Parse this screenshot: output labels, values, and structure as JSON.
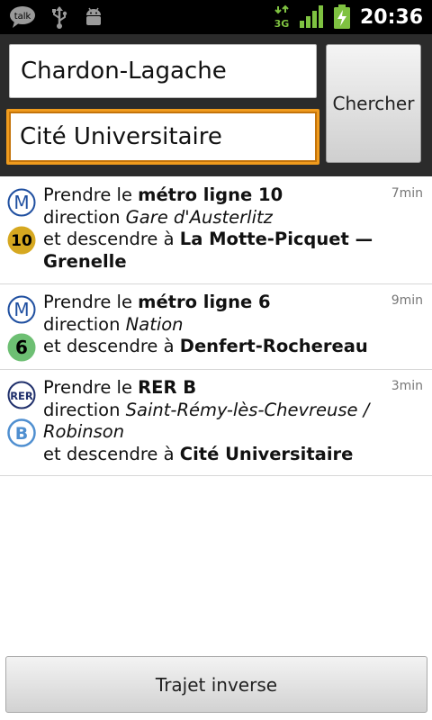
{
  "status_bar": {
    "time": "20:36",
    "talk_label": "talk",
    "network_label": "3G",
    "icons": [
      "talk-icon",
      "usb-icon",
      "android-debug-icon",
      "network-3g-icon",
      "signal-icon",
      "battery-charging-icon"
    ]
  },
  "search": {
    "from_value": "Chardon-Lagache",
    "to_value": "Cité Universitaire",
    "search_label": "Chercher"
  },
  "steps": [
    {
      "mode_icon": "M",
      "line_label": "10",
      "line_color": "#d6a820",
      "take": "Prendre le ",
      "line": "métro ligne 10",
      "direction_prefix": "direction ",
      "direction": "Gare d'Austerlitz",
      "stop_prefix": "et descendre à ",
      "stop": "La Motte-Picquet — Grenelle",
      "duration": "7min"
    },
    {
      "mode_icon": "M",
      "line_label": "6",
      "line_color": "#6dbf73",
      "take": "Prendre le ",
      "line": "métro ligne 6",
      "direction_prefix": "direction ",
      "direction": "Nation",
      "stop_prefix": "et descendre à ",
      "stop": "Denfert-Rochereau",
      "duration": "9min"
    },
    {
      "mode_icon": "RER",
      "line_label": "B",
      "line_color": "#4f8fd0",
      "take": "Prendre le ",
      "line": "RER B",
      "direction_prefix": "direction ",
      "direction": "Saint-Rémy-lès-Chevreuse / Robinson",
      "stop_prefix": "et descendre à ",
      "stop": "Cité Universitaire",
      "duration": "3min"
    }
  ],
  "reverse_label": "Trajet inverse"
}
